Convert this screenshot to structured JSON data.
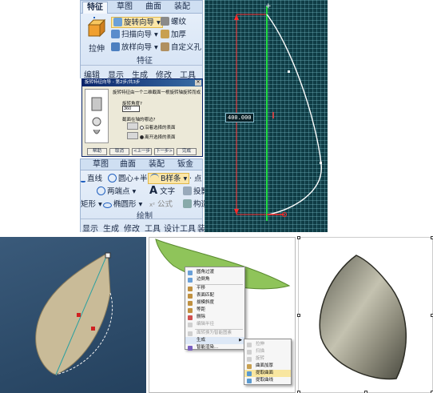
{
  "ribbon_top": {
    "tabs": [
      "特征",
      "草图",
      "曲面",
      "装配"
    ],
    "extrude_label": "拉伸",
    "commands": [
      "旋转向导",
      "扫描向导",
      "放样向导",
      "螺纹",
      "加厚",
      "自定义孔"
    ],
    "group_label": "特征",
    "menu": [
      "编辑",
      "显示",
      "生成",
      "修改",
      "工具"
    ]
  },
  "dialog": {
    "title": "旋转特征向导 - 第2步/共3步",
    "close": "×",
    "intro": "旋转特征由一个二维截面一根旋转轴旋转而成",
    "angle_label": "旋转角度?",
    "angle_value": "360",
    "direction_label": "截面在轴的哪边?",
    "option_a": "沿着选择的表面",
    "option_b": "离开选择的表面",
    "buttons": [
      "帮助",
      "取消",
      "<上一步",
      "下一步>",
      "完成"
    ]
  },
  "ribbon_sketch": {
    "tabs": [
      "草图",
      "曲面",
      "装配",
      "钣金"
    ],
    "row1": [
      "直线",
      "圆心+半径",
      "B样条",
      "点"
    ],
    "row2": [
      "两端点",
      "文字",
      "投影"
    ],
    "row3": [
      "矩形",
      "椭圆形",
      "公式",
      "构造"
    ],
    "group_label": "绘制",
    "menu": [
      "显示",
      "生成",
      "修改",
      "工具",
      "设计工具",
      "装"
    ]
  },
  "canvas": {
    "dimension": "400.000"
  },
  "context_menu": {
    "items": [
      {
        "label": "圆角过渡",
        "disabled": false
      },
      {
        "label": "边倒角",
        "disabled": false
      },
      {
        "label": "平移",
        "disabled": false
      },
      {
        "label": "表面匹配",
        "disabled": false
      },
      {
        "label": "拔模斜度",
        "disabled": false
      },
      {
        "label": "等距",
        "disabled": false
      },
      {
        "label": "删除",
        "disabled": false
      },
      {
        "label": "编辑半径",
        "disabled": true
      },
      {
        "label": "面转换为智能图素",
        "disabled": true
      },
      {
        "label": "生成",
        "disabled": false,
        "submenu": true
      },
      {
        "label": "智能渲染...",
        "disabled": false
      }
    ],
    "submenu": [
      {
        "label": "拉伸",
        "disabled": true
      },
      {
        "label": "扫描",
        "disabled": true
      },
      {
        "label": "旋转",
        "disabled": true
      },
      {
        "label": "曲面加厚",
        "disabled": false
      },
      {
        "label": "提取曲面",
        "disabled": false,
        "highlight": true
      },
      {
        "label": "提取曲线",
        "disabled": false
      }
    ]
  },
  "colors": {
    "canvas_bg": "#0f3c45",
    "sketch_curve": "#ffffff",
    "dimension_line": "#ff2a2a",
    "axis_line": "#22dd44",
    "leaf_fill": "#c8b89a",
    "leaf_green": "#8fc45a",
    "leaf_metal": "#7a7a6a"
  }
}
